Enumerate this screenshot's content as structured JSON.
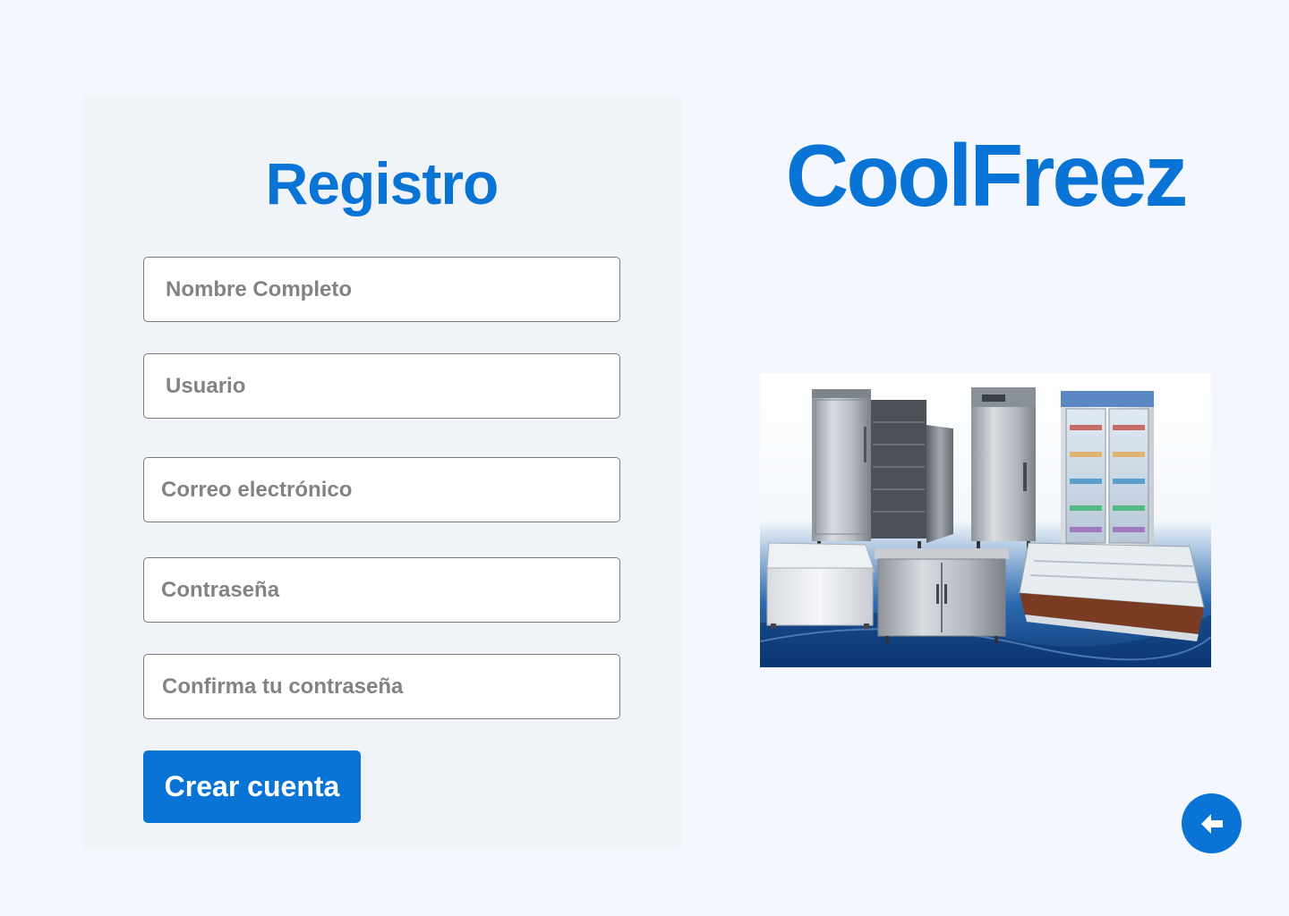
{
  "form": {
    "title": "Registro",
    "fields": {
      "full_name": "Nombre Completo",
      "username": "Usuario",
      "email": "Correo electrónico",
      "password": "Contraseña",
      "confirm_password": "Confirma tu contraseña"
    },
    "submit_label": "Crear cuenta"
  },
  "brand": {
    "name": "CoolFreez"
  },
  "image": {
    "subject": "commercial refrigerators, freezers and display cases"
  },
  "back_button": {
    "icon": "arrow-left-icon"
  },
  "colors": {
    "accent": "#0a74d6",
    "background": "#f4f7fd",
    "card": "#f0f4f9"
  }
}
